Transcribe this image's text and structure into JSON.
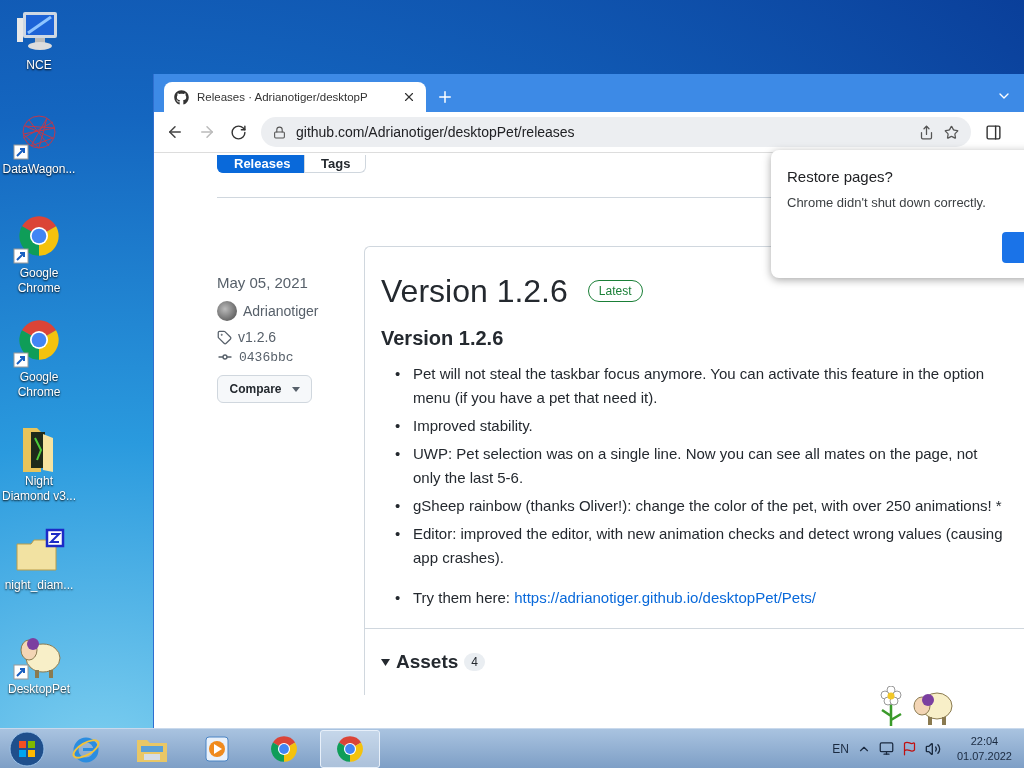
{
  "desktop_icons": [
    {
      "label": "NCE",
      "kind": "computer",
      "shortcut": false
    },
    {
      "label": "DataWagon...",
      "kind": "graph",
      "shortcut": true
    },
    {
      "label": "Google Chrome",
      "kind": "chrome",
      "shortcut": true
    },
    {
      "label": "Google Chrome",
      "kind": "chrome",
      "shortcut": true
    },
    {
      "label": "Night Diamond v3...",
      "kind": "folder",
      "shortcut": false
    },
    {
      "label": "night_diam...",
      "kind": "zip",
      "shortcut": false
    },
    {
      "label": "DesktopPet",
      "kind": "sheep",
      "shortcut": true
    }
  ],
  "browser": {
    "tab_title": "Releases · Adrianotiger/desktopP",
    "url": "github.com/Adrianotiger/desktopPet/releases",
    "forward_disabled": true,
    "release_tabs": [
      {
        "label": "Releases",
        "selected": true
      },
      {
        "label": "Tags",
        "selected": false
      }
    ],
    "date": "May 05, 2021",
    "author": "Adrianotiger",
    "tag": "v1.2.6",
    "commit": "0436bbc",
    "compare_button": "Compare",
    "title": "Version 1.2.6",
    "badge": "Latest",
    "heading": "Version 1.2.6",
    "notes": [
      {
        "marker": "•",
        "text": "Pet will not steal the taskbar focus anymore. You can activate this feature in the option menu (if you have a pet that need it)."
      },
      {
        "marker": "•",
        "text": "Improved stability."
      },
      {
        "marker": "•",
        "text": "UWP: Pet selection was on a single line. Now you can see all mates on the page, not only the last 5-6."
      },
      {
        "marker": "•",
        "text": "gSheep rainbow (thanks Oliver!): change the color of the pet, with over 250 animations! *"
      },
      {
        "marker": "•",
        "text": "Editor: improved the editor, with new animation checks and detect wrong values (causing app crashes)."
      },
      {
        "marker": "•",
        "text": "Try them here: ",
        "link": "https://adrianotiger.github.io/desktopPet/Pets/"
      }
    ],
    "assets_label": "Assets",
    "assets_count": "4",
    "popup": {
      "title": "Restore pages?",
      "message": "Chrome didn't shut down correctly."
    }
  },
  "taskbar": {
    "apps": [
      {
        "kind": "ie",
        "active": false
      },
      {
        "kind": "explorer",
        "active": false
      },
      {
        "kind": "media",
        "active": false
      },
      {
        "kind": "chrome",
        "active": false
      },
      {
        "kind": "chrome",
        "active": true
      }
    ],
    "language": "EN",
    "time": "22:04",
    "date": "01.07.2022"
  }
}
